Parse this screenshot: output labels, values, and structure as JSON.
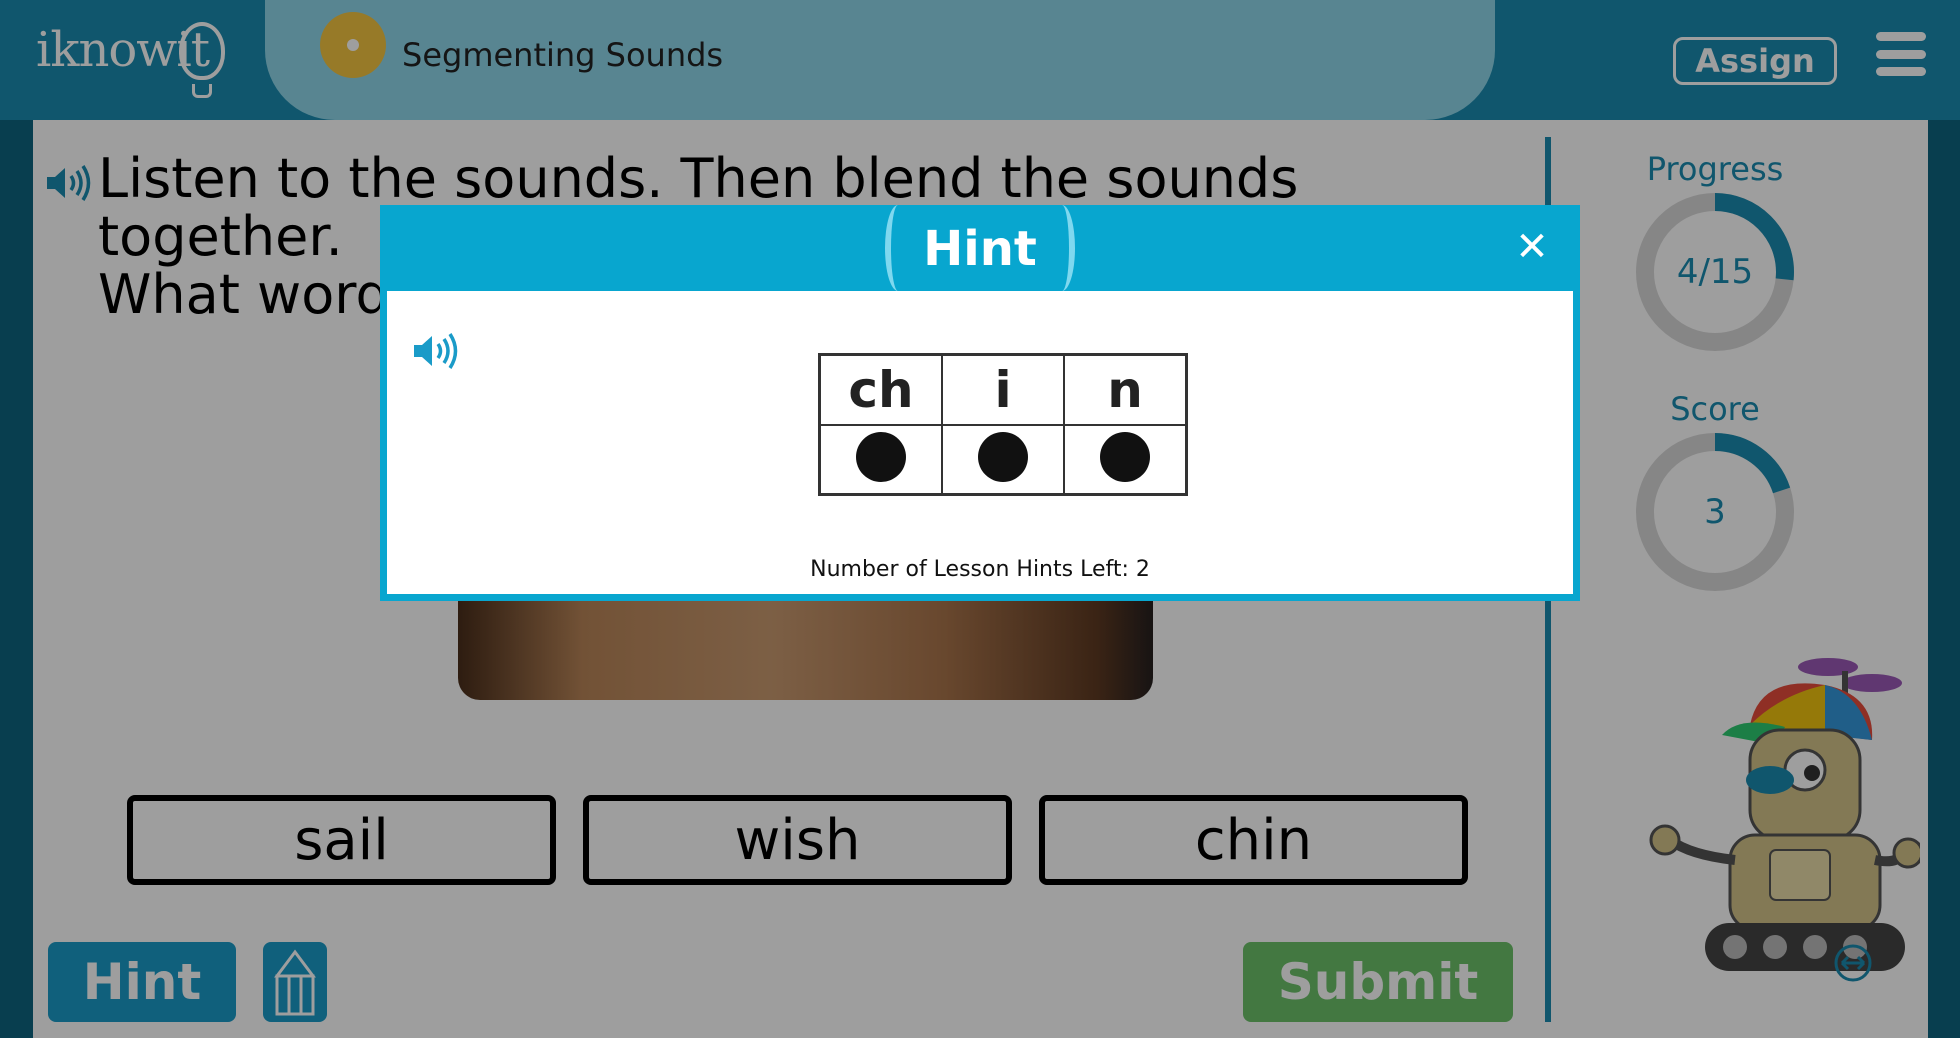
{
  "header": {
    "logo_text": "iknowit",
    "lesson_title": "Segmenting Sounds",
    "assign_label": "Assign"
  },
  "question": {
    "line1": "Listen to the sounds. Then blend the sounds together.",
    "line2": "What word"
  },
  "choices": [
    "sail",
    "wish",
    "chin"
  ],
  "footer": {
    "hint_label": "Hint",
    "submit_label": "Submit"
  },
  "sidebar": {
    "progress_label": "Progress",
    "progress_value": "4/15",
    "progress_fraction": 0.2667,
    "score_label": "Score",
    "score_value": "3",
    "score_fraction": 0.2
  },
  "modal": {
    "title": "Hint",
    "close_glyph": "✕",
    "sounds": [
      "ch",
      "i",
      "n"
    ],
    "hints_left_text": "Number of Lesson Hints Left: 2"
  },
  "colors": {
    "header": "#1a8cb0",
    "accent": "#08a6cf",
    "submit": "#6cc26a",
    "ring_track": "#d9d9d9"
  },
  "icons": [
    "speaker-icon",
    "menu-icon",
    "close-icon",
    "pencil-icon",
    "robot-mascot",
    "expand-icon"
  ]
}
